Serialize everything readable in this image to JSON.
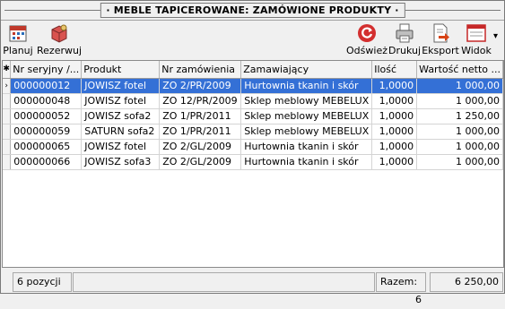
{
  "window": {
    "title": "· MEBLE TAPICEROWANE: ZAMÓWIONE PRODUKTY ·"
  },
  "toolbar": {
    "left": [
      {
        "label": "Planuj",
        "icon": "calendar-icon"
      },
      {
        "label": "Rezerwuj",
        "icon": "reserve-icon"
      }
    ],
    "right": [
      {
        "label": "Odśwież",
        "icon": "refresh-icon"
      },
      {
        "label": "Drukuj",
        "icon": "print-icon"
      },
      {
        "label": "Eksport",
        "icon": "export-icon"
      },
      {
        "label": "Widok",
        "icon": "view-icon"
      }
    ],
    "more_glyph": "▾"
  },
  "grid": {
    "indicator_header": "✱",
    "columns": [
      "Nr seryjny /...",
      "Produkt",
      "Nr zamówienia",
      "Zamawiający",
      "Ilość",
      "Wartość netto ..."
    ],
    "rows": [
      {
        "indicator": "›",
        "cells": [
          "000000012",
          "JOWISZ fotel",
          "ZO 2/PR/2009",
          "Hurtownia tkanin i skór",
          "1,0000",
          "1 000,00"
        ]
      },
      {
        "indicator": "",
        "cells": [
          "000000048",
          "JOWISZ fotel",
          "ZO 12/PR/2009",
          "Sklep meblowy MEBELUX",
          "1,0000",
          "1 000,00"
        ]
      },
      {
        "indicator": "",
        "cells": [
          "000000052",
          "JOWISZ sofa2",
          "ZO 1/PR/2011",
          "Sklep meblowy MEBELUX",
          "1,0000",
          "1 250,00"
        ]
      },
      {
        "indicator": "",
        "cells": [
          "000000059",
          "SATURN sofa2",
          "ZO 1/PR/2011",
          "Sklep meblowy MEBELUX",
          "1,0000",
          "1 000,00"
        ]
      },
      {
        "indicator": "",
        "cells": [
          "000000065",
          "JOWISZ fotel",
          "ZO 2/GL/2009",
          "Hurtownia tkanin i skór",
          "1,0000",
          "1 000,00"
        ]
      },
      {
        "indicator": "",
        "cells": [
          "000000066",
          "JOWISZ sofa3",
          "ZO 2/GL/2009",
          "Hurtownia tkanin i skór",
          "1,0000",
          "1 000,00"
        ]
      }
    ],
    "selected_row": 0,
    "colors": {
      "selection": "#3470d6"
    }
  },
  "status": {
    "count": "6 pozycji",
    "total_label": "Razem:",
    "total_count": "6",
    "total_value": "6 250,00"
  }
}
